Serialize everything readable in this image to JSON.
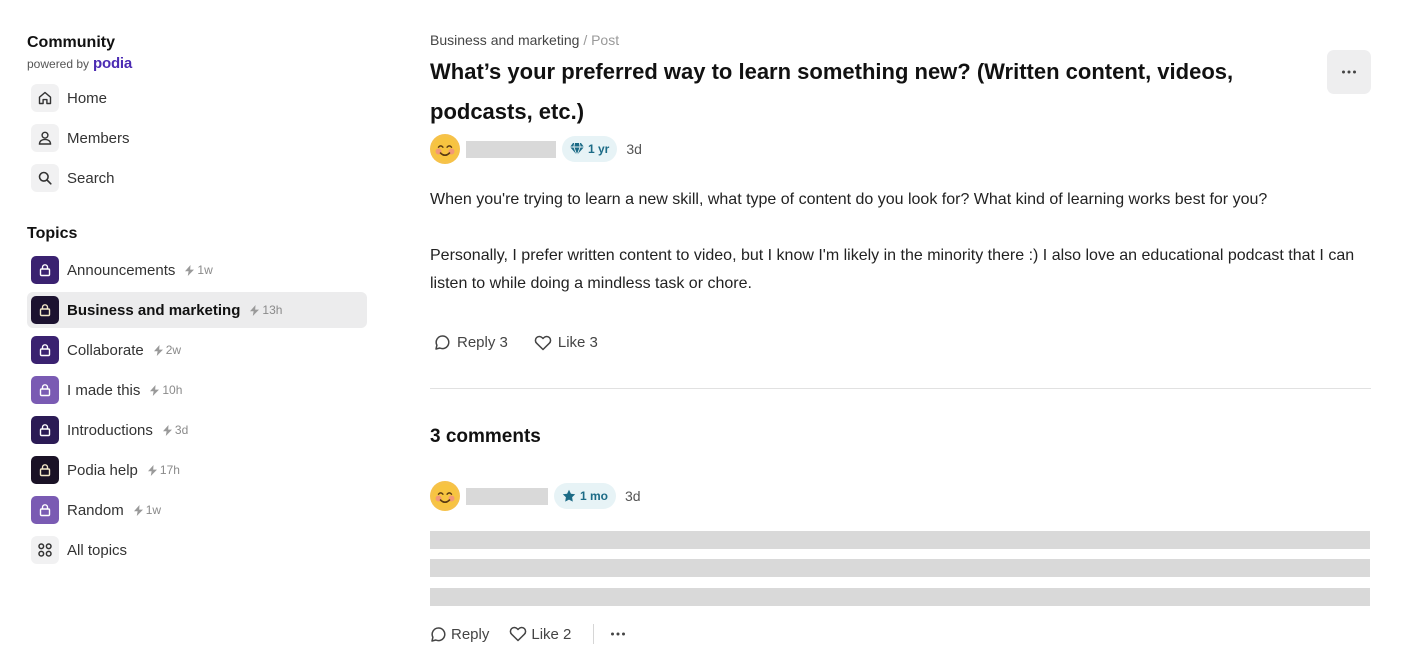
{
  "sidebar": {
    "brand_title": "Community",
    "powered_by": "powered by",
    "brand_name": "podia",
    "nav": [
      {
        "label": "Home",
        "icon": "home-icon"
      },
      {
        "label": "Members",
        "icon": "user-icon"
      },
      {
        "label": "Search",
        "icon": "search-icon"
      }
    ],
    "topics_heading": "Topics",
    "topics": [
      {
        "name": "Announcements",
        "age": "1w",
        "color": "#3a2270"
      },
      {
        "name": "Business and marketing",
        "age": "13h",
        "color": "#1c1230",
        "active": true
      },
      {
        "name": "Collaborate",
        "age": "2w",
        "color": "#3a2270"
      },
      {
        "name": "I made this",
        "age": "10h",
        "color": "#7a5bb3"
      },
      {
        "name": "Introductions",
        "age": "3d",
        "color": "#2b1b55"
      },
      {
        "name": "Podia help",
        "age": "17h",
        "color": "#1a1226"
      },
      {
        "name": "Random",
        "age": "1w",
        "color": "#7a5bb3"
      }
    ],
    "all_topics": "All topics"
  },
  "post": {
    "breadcrumb_topic": "Business and marketing",
    "breadcrumb_sep": "/",
    "breadcrumb_page": "Post",
    "title": "What’s your preferred way to learn something new? (Written content, videos, podcasts, etc.)",
    "badge": "1 yr",
    "time": "3d",
    "paragraphs": [
      "When you're trying to learn a new skill, what type of content do you look for? What kind of learning works best for you?",
      "Personally, I prefer written content to video, but I know I'm likely in the minority there :) I also love an educational podcast that I can listen to while doing a mindless task or chore."
    ],
    "reply_label": "Reply 3",
    "like_label": "Like 3"
  },
  "comments": {
    "heading": "3 comments",
    "first": {
      "badge": "1 mo",
      "time": "3d",
      "reply_label": "Reply",
      "like_label": "Like 2"
    }
  },
  "colors": {
    "accent": "#4b2bb3",
    "badge_text": "#1c6b86",
    "badge_bg": "#e7f3f6"
  }
}
